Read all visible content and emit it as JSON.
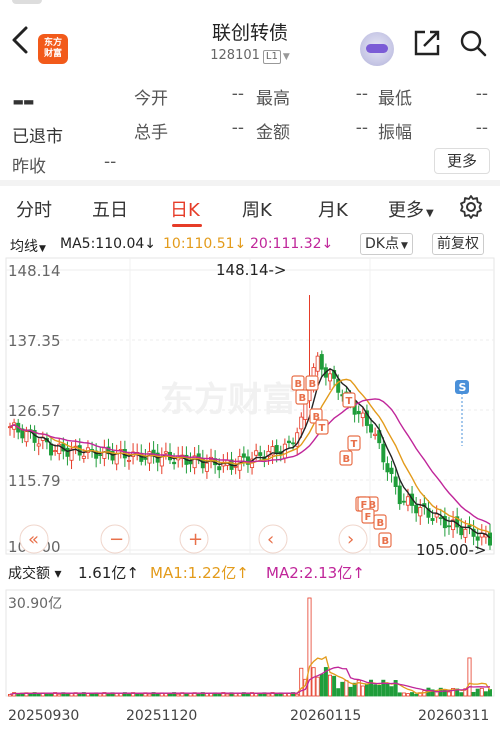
{
  "header": {
    "logo_line1": "东方",
    "logo_line2": "财富",
    "title": "联创转债",
    "code": "128101",
    "level_badge": "L1"
  },
  "quote": {
    "price": "--",
    "status": "已退市",
    "prev_close_label": "昨收",
    "prev_close_value": "--",
    "fields": [
      {
        "label": "今开",
        "value": "--"
      },
      {
        "label": "最高",
        "value": "--"
      },
      {
        "label": "最低",
        "value": "--"
      },
      {
        "label": "总手",
        "value": "--"
      },
      {
        "label": "金额",
        "value": "--"
      },
      {
        "label": "振幅",
        "value": "--"
      }
    ],
    "more_label": "更多"
  },
  "tabs": [
    {
      "label": "分时",
      "active": false
    },
    {
      "label": "五日",
      "active": false
    },
    {
      "label": "日K",
      "active": true
    },
    {
      "label": "周K",
      "active": false
    },
    {
      "label": "月K",
      "active": false
    },
    {
      "label": "更多",
      "active": false
    }
  ],
  "ma_bar": {
    "selector": "均线",
    "ma5": "MA5:110.04↓",
    "ma10": "10:110.51↓",
    "ma20": "20:111.32↓",
    "dk_label": "DK点",
    "adjust_label": "前复权"
  },
  "volume_bar": {
    "selector": "成交额",
    "value": "1.61亿↑",
    "ma1": "MA1:1.22亿↑",
    "ma2": "MA2:2.13亿↑"
  },
  "colors": {
    "up": "#e63c28",
    "down": "#1f9d3a",
    "ma5": "#222222",
    "ma10": "#e39b1b",
    "ma20": "#c0269a",
    "signal_b": "#e8704a",
    "signal_s": "#4a90d9",
    "accent": "#e63c28"
  },
  "chart_data": {
    "type": "candlestick",
    "y_ticks": [
      "148.14",
      "137.35",
      "126.57",
      "115.79",
      "105.00"
    ],
    "ylim": [
      105.0,
      148.14
    ],
    "x_ticks": [
      "20250930",
      "20251120",
      "20260115",
      "20260311"
    ],
    "max_label": "148.14->",
    "min_label": "105.00->",
    "volume_max_label": "30.90亿",
    "watermark": "东方财富",
    "nav_buttons": [
      "«",
      "−",
      "+",
      "‹",
      "›"
    ]
  }
}
